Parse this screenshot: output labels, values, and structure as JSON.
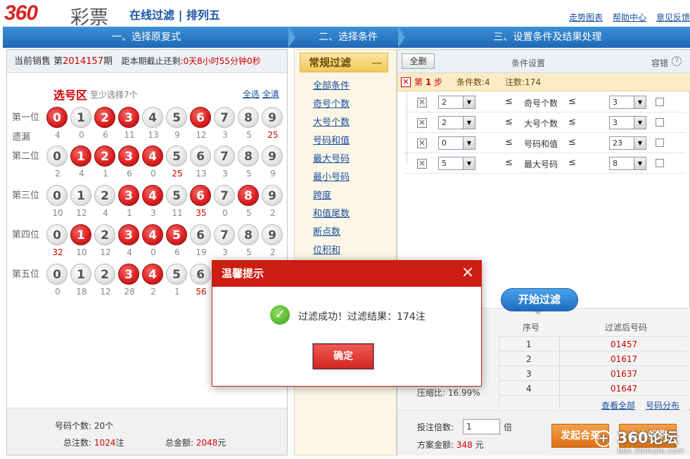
{
  "header": {
    "logo_num": "360",
    "logo_cn": "彩票",
    "subtitle": "在线过滤 | 排列五",
    "links": [
      "走势图表",
      "帮助中心",
      "意见反馈"
    ]
  },
  "steps": [
    "一、选择原复式",
    "二、选择条件",
    "三、设置条件及结果处理"
  ],
  "sales": {
    "prefix": "当前销售 第",
    "issue": "2014157",
    "issue_suffix": "期",
    "deadline_label": "距本期截止还剩:",
    "deadline_value": "0天8小时55分钟0秒"
  },
  "pick": {
    "title": "选号区",
    "hint": "至少选择7个",
    "select_all": "全选",
    "clear_all": "全清",
    "miss_label": "遗漏",
    "rows": [
      {
        "label": "第一位",
        "selected": [
          0,
          2,
          3,
          6
        ],
        "miss": [
          "4",
          "0",
          "6",
          "11",
          "13",
          "9",
          "12",
          "3",
          "5",
          "25"
        ],
        "hot": [
          9
        ]
      },
      {
        "label": "第二位",
        "selected": [
          1,
          2,
          3,
          4
        ],
        "miss": [
          "2",
          "4",
          "1",
          "6",
          "0",
          "25",
          "13",
          "3",
          "5",
          "9"
        ],
        "hot": [
          5
        ]
      },
      {
        "label": "第三位",
        "selected": [
          3,
          4,
          6,
          8
        ],
        "miss": [
          "10",
          "12",
          "4",
          "1",
          "3",
          "11",
          "35",
          "0",
          "5",
          "2"
        ],
        "hot": [
          6
        ]
      },
      {
        "label": "第四位",
        "selected": [
          1,
          3,
          4,
          5
        ],
        "miss": [
          "32",
          "10",
          "12",
          "4",
          "0",
          "6",
          "19",
          "3",
          "5",
          "2"
        ],
        "hot": [
          0
        ]
      },
      {
        "label": "第五位",
        "selected": [
          3,
          4
        ],
        "miss": [
          "0",
          "18",
          "12",
          "28",
          "2",
          "1",
          "56"
        ],
        "hot": [
          6
        ]
      }
    ]
  },
  "left_footer": {
    "count_label": "号码个数:",
    "count_value": "20个",
    "total_bets_label": "总注数:",
    "total_bets_value": "1024",
    "total_bets_unit": "注",
    "total_amount_label": "总金额:",
    "total_amount_value": "2048",
    "total_amount_unit": "元"
  },
  "conditions": {
    "header": "常规过滤",
    "collapse": "—",
    "items": [
      "全部条件",
      "奇号个数",
      "大号个数",
      "号码和值",
      "最大号码",
      "最小号码",
      "跨度",
      "和值尾数",
      "断点数",
      "位积和"
    ]
  },
  "settings": {
    "delete_all": "全删",
    "title": "条件设置",
    "tolerance": "容错",
    "help": "?",
    "step_label_pre": "第",
    "step_num": "1",
    "step_label_post": "步",
    "cond_count": "条件数:4",
    "bet_count": "注数:174",
    "op": "≤",
    "rows": [
      {
        "min": "2",
        "name": "奇号个数",
        "max": "3"
      },
      {
        "min": "2",
        "name": "大号个数",
        "max": "3"
      },
      {
        "min": "0",
        "name": "号码和值",
        "max": "23"
      },
      {
        "min": "5",
        "name": "最大号码",
        "max": "8"
      }
    ]
  },
  "filter": {
    "start": "开始过滤",
    "col_index": "序号",
    "col_number": "过滤后号码",
    "rows": [
      {
        "idx": "1",
        "num": "01457"
      },
      {
        "idx": "2",
        "num": "01617"
      },
      {
        "idx": "3",
        "num": "01637"
      },
      {
        "idx": "4",
        "num": "01647"
      }
    ],
    "compress_label": "压缩比:",
    "compress_value": "16.99%",
    "view_all": "查看全部",
    "distribution": "号码分布"
  },
  "bottom": {
    "multiple_label": "投注倍数:",
    "multiple_value": "1",
    "multiple_unit": "倍",
    "amount_label": "方案金额:",
    "amount_value": "348",
    "amount_unit": "元",
    "btn_group": "发起合买",
    "btn_agent": "个人代购"
  },
  "watermark": {
    "mark": "360论坛",
    "url": "bbs.360safe.com"
  },
  "modal": {
    "title": "温馨提示",
    "close": "×",
    "message": "过滤成功！过滤结果：174注",
    "confirm": "确定"
  },
  "colors": {
    "accent_red": "#cc1d12",
    "brand_blue": "#1f68b5",
    "condition_gold": "#f1c95b"
  }
}
